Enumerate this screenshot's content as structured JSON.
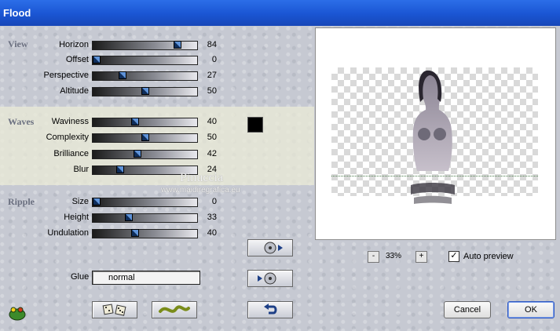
{
  "window": {
    "title": "Flood"
  },
  "groups": {
    "view": "View",
    "waves": "Waves",
    "ripple": "Ripple"
  },
  "params": [
    {
      "label": "Horizon",
      "value": "84",
      "fraction": 0.84
    },
    {
      "label": "Offset",
      "value": "0",
      "fraction": 0.0
    },
    {
      "label": "Perspective",
      "value": "27",
      "fraction": 0.27
    },
    {
      "label": "Altitude",
      "value": "50",
      "fraction": 0.5
    },
    {
      "label": "Waviness",
      "value": "40",
      "fraction": 0.4
    },
    {
      "label": "Complexity",
      "value": "50",
      "fraction": 0.5
    },
    {
      "label": "Brilliance",
      "value": "42",
      "fraction": 0.42
    },
    {
      "label": "Blur",
      "value": "24",
      "fraction": 0.24
    },
    {
      "label": "Size",
      "value": "0",
      "fraction": 0.0
    },
    {
      "label": "Height",
      "value": "33",
      "fraction": 0.33
    },
    {
      "label": "Undulation",
      "value": "40",
      "fraction": 0.4
    }
  ],
  "waves_color": "#000000",
  "glue": {
    "label": "Glue",
    "value": "normal"
  },
  "zoom": {
    "minus": "-",
    "value": "33%",
    "plus": "+"
  },
  "auto_preview": {
    "label": "Auto preview",
    "checked": true,
    "mark": "✓"
  },
  "buttons": {
    "cancel": "Cancel",
    "ok": "OK"
  },
  "watermark": {
    "name": "Pinuccia",
    "url": "www.maidiregrafica.eu"
  },
  "icons": {
    "logo": "frog-icon",
    "randomize": "dice-icon",
    "wave": "wave-icon",
    "load_preset": "cd-load-icon",
    "save_preset": "cd-save-icon",
    "reset": "undo-icon"
  }
}
